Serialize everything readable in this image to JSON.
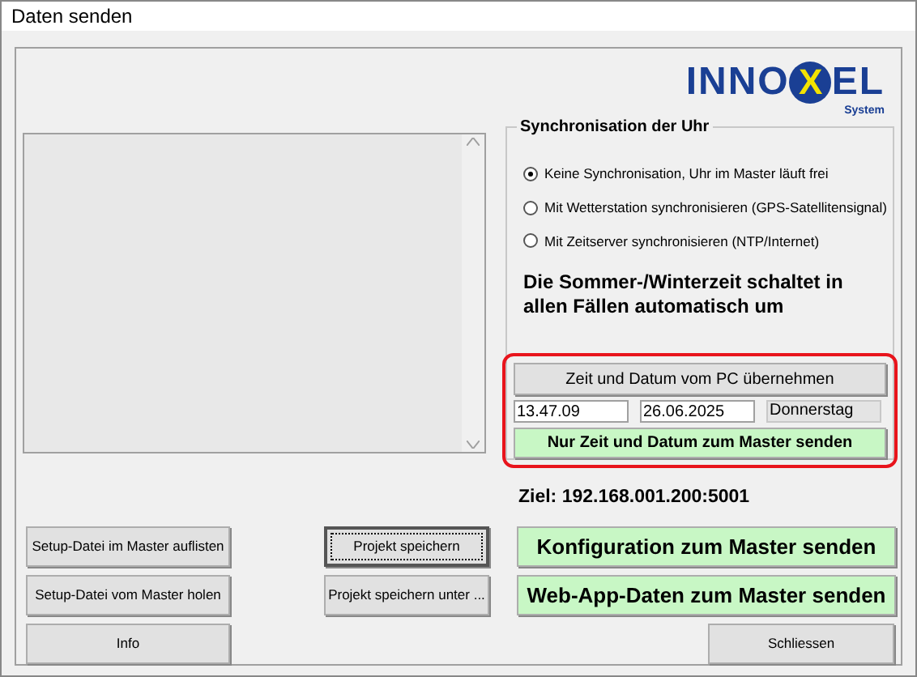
{
  "window": {
    "title": "Daten senden"
  },
  "logo": {
    "part_1": "INNO",
    "part_2": "X",
    "part_3": "EL",
    "subtitle": "System"
  },
  "sync": {
    "title": "Synchronisation der Uhr",
    "options": [
      {
        "label": "Keine Synchronisation, Uhr im Master läuft frei",
        "selected": true
      },
      {
        "label": "Mit Wetterstation synchronisieren (GPS-Satellitensignal)",
        "selected": false
      },
      {
        "label": "Mit Zeitserver synchronisieren (NTP/Internet)",
        "selected": false
      }
    ],
    "note": "Die Sommer-/Winterzeit schaltet in allen Fällen automatisch um",
    "take_button": "Zeit und Datum vom PC übernehmen",
    "time": "13.47.09",
    "date": "26.06.2025",
    "weekday": "Donnerstag",
    "send_button": "Nur Zeit und Datum zum Master senden"
  },
  "target": "Ziel: 192.168.001.200:5001",
  "buttons": [
    {
      "label": "Setup-Datei im Master auflisten",
      "kind": "plain"
    },
    {
      "label": "Projekt speichern",
      "kind": "default"
    },
    {
      "label": "Konfiguration zum Master senden",
      "kind": "action"
    },
    {
      "label": "Setup-Datei vom Master holen",
      "kind": "plain"
    },
    {
      "label": "Projekt speichern unter ...",
      "kind": "plain"
    },
    {
      "label": "Web-App-Daten zum Master senden",
      "kind": "action"
    },
    {
      "label": "Info",
      "kind": "plain"
    },
    {
      "label": "Schliessen",
      "kind": "plain"
    }
  ]
}
